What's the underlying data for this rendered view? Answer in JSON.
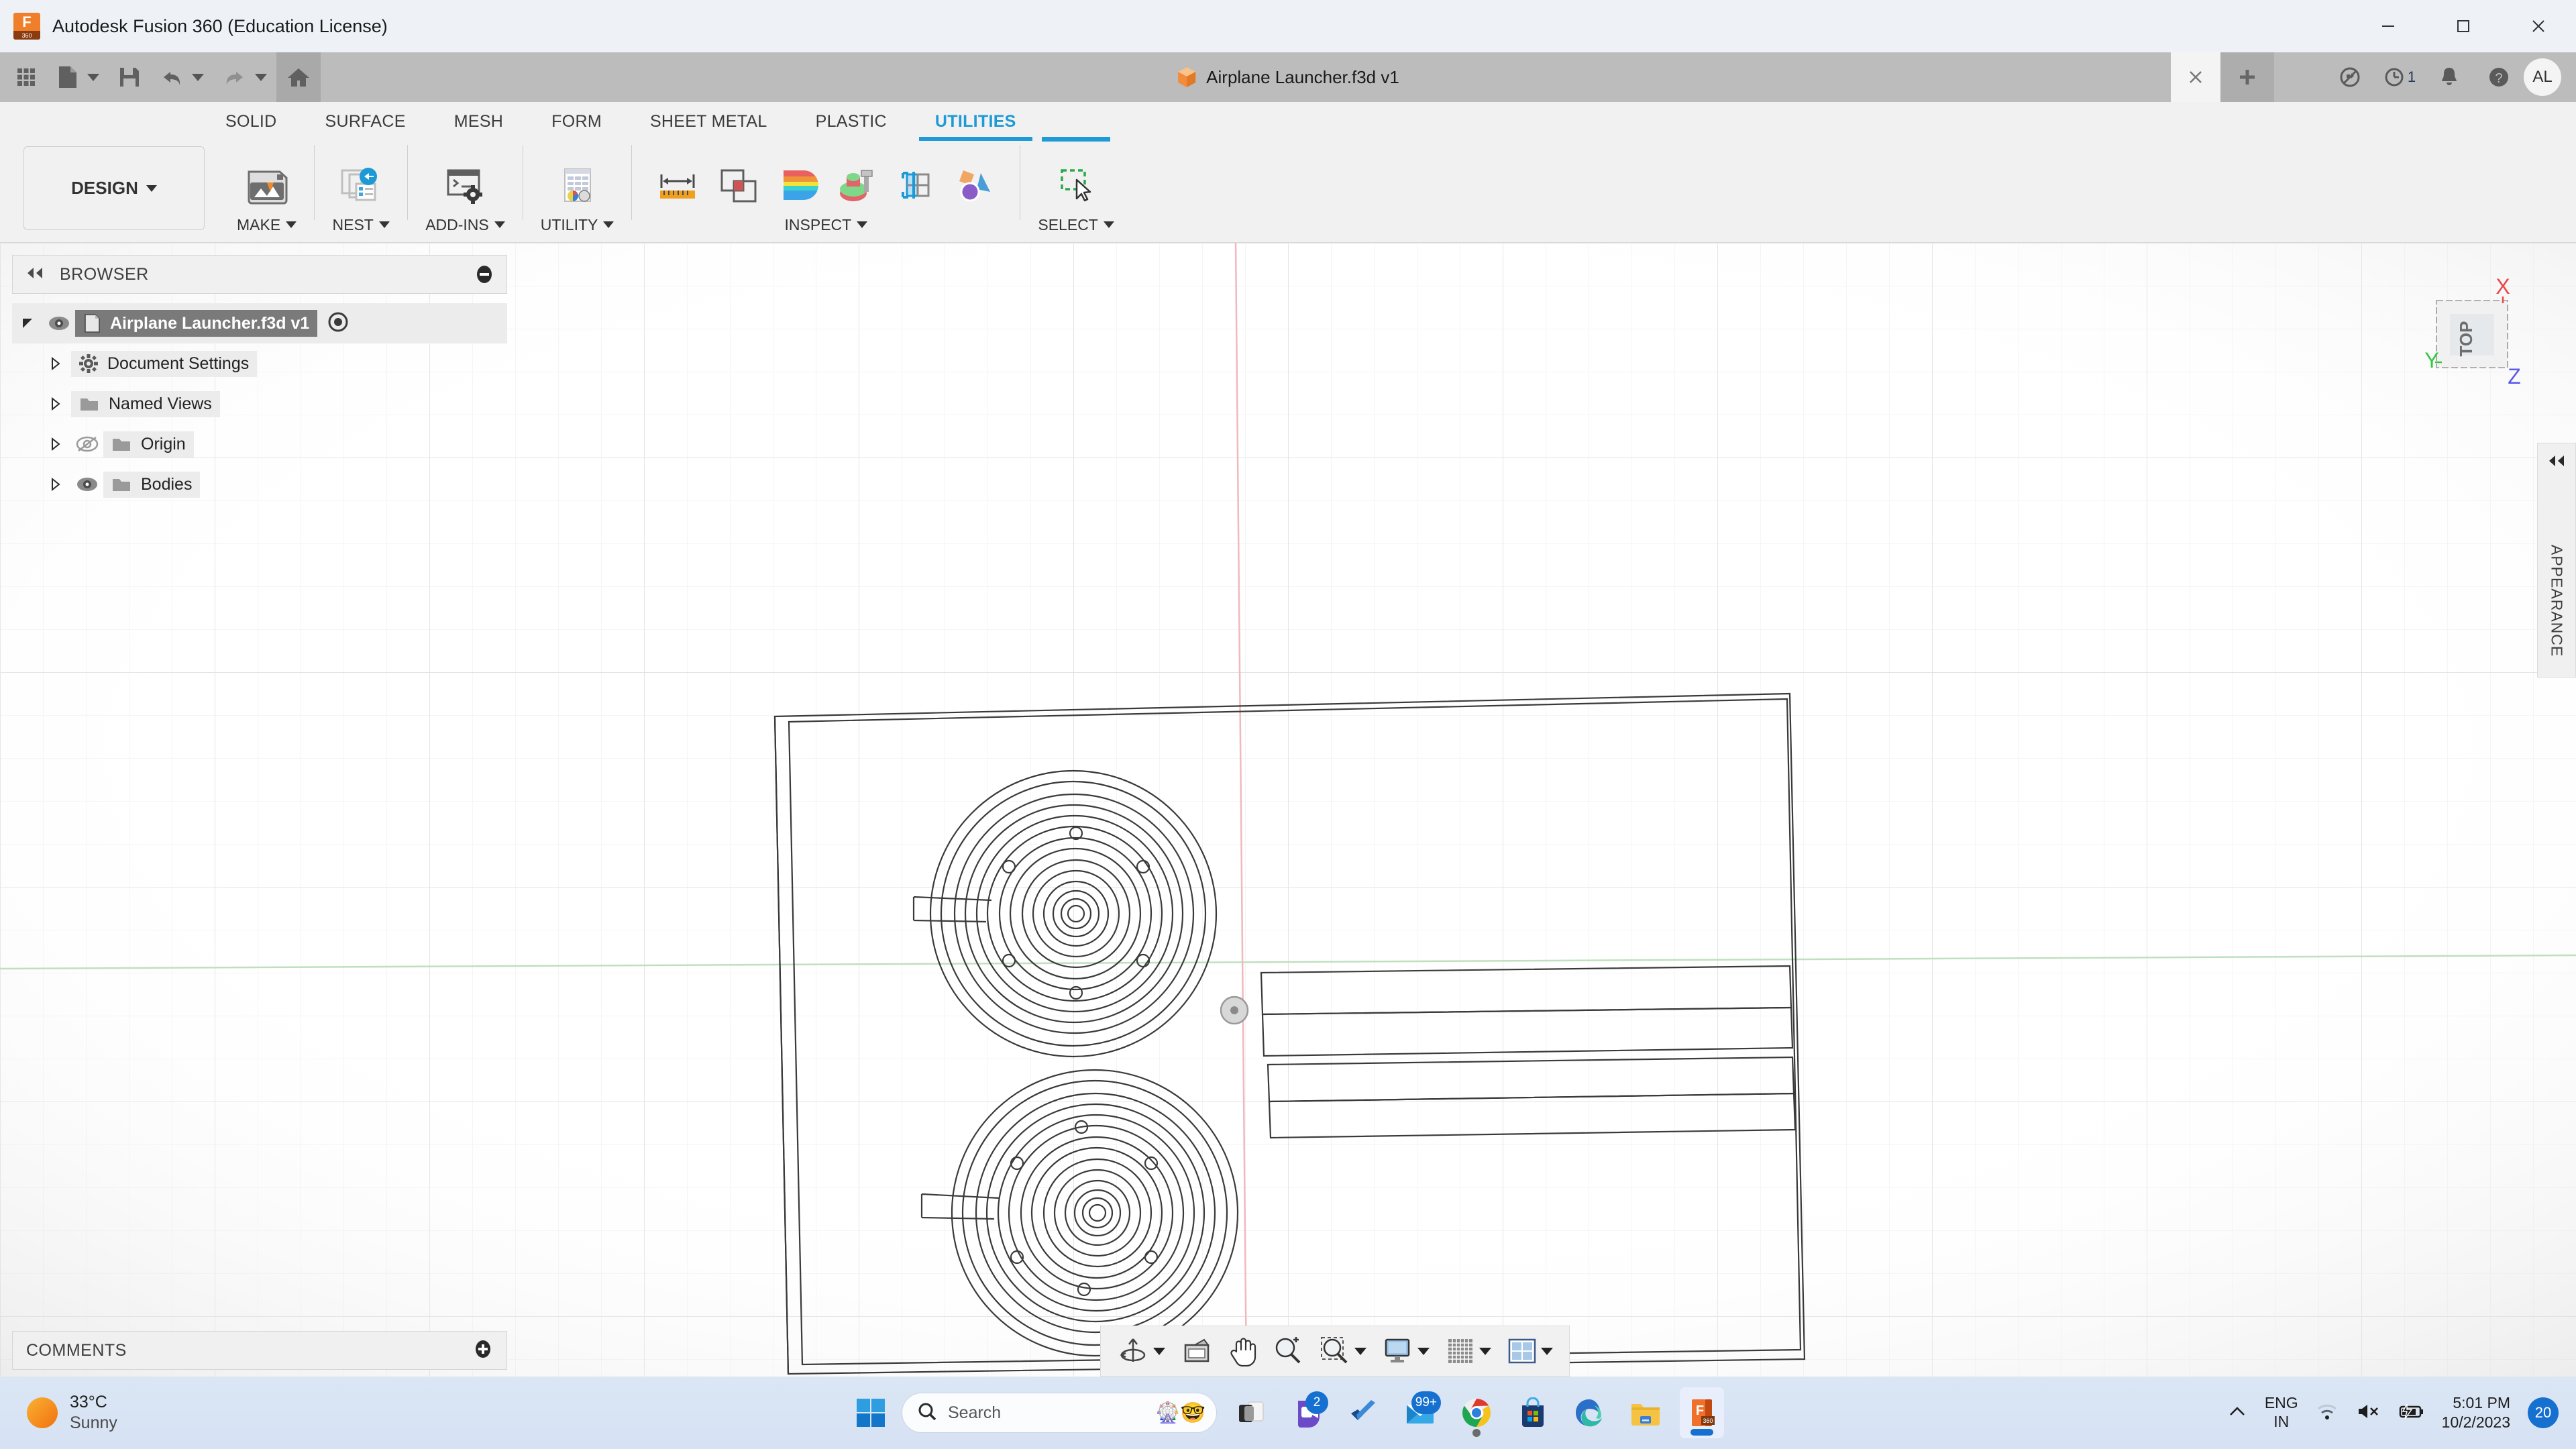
{
  "window": {
    "title": "Autodesk Fusion 360 (Education License)",
    "logo_icon": "fusion360-logo-icon",
    "logo_text": "F",
    "logo_sub": "360",
    "minimize_icon": "minimize-icon",
    "maximize_icon": "maximize-icon",
    "close_icon": "close-icon"
  },
  "quick_access": {
    "apps_icon": "grid-apps-icon",
    "new_file_icon": "new-file-icon",
    "save_icon": "save-icon",
    "undo_icon": "undo-icon",
    "redo_icon": "redo-icon",
    "home_icon": "home-icon"
  },
  "document_tab": {
    "label": "Airplane Launcher.f3d v1",
    "icon": "orange-cube-icon",
    "close_icon": "close-tab-icon",
    "add_icon": "add-tab-icon"
  },
  "status_icons": {
    "offline_icon": "cloud-offline-icon",
    "jobs_icon": "job-status-clock-icon",
    "jobs_count": "1",
    "notifications_icon": "bell-icon",
    "help_icon": "help-question-icon",
    "avatar_initials": "AL"
  },
  "ribbon": {
    "design_label": "DESIGN",
    "tabs": [
      {
        "label": "SOLID",
        "active": false
      },
      {
        "label": "SURFACE",
        "active": false
      },
      {
        "label": "MESH",
        "active": false
      },
      {
        "label": "FORM",
        "active": false
      },
      {
        "label": "SHEET METAL",
        "active": false
      },
      {
        "label": "PLASTIC",
        "active": false
      },
      {
        "label": "UTILITIES",
        "active": true
      }
    ],
    "panels": [
      {
        "label": "MAKE",
        "icon": "3d-print-icon"
      },
      {
        "label": "NEST",
        "icon": "nest-plugin-icon"
      },
      {
        "label": "ADD-INS",
        "icon": "addins-console-gear-icon"
      },
      {
        "label": "UTILITY",
        "icon": "utility-report-icon"
      },
      {
        "label": "INSPECT",
        "icon": "inspect-panel"
      },
      {
        "label": "SELECT",
        "icon": "select-marquee-cursor-icon"
      }
    ],
    "inspect_tools": [
      {
        "name": "measure-icon"
      },
      {
        "name": "interference-icon"
      },
      {
        "name": "curvature-comb-icon"
      },
      {
        "name": "zebra-analysis-icon"
      },
      {
        "name": "section-analysis-icon"
      },
      {
        "name": "component-color-toggle-icon"
      }
    ]
  },
  "browser": {
    "title": "BROWSER",
    "collapse_icon": "collapse-left-icon",
    "minimize_icon": "minus-circle-icon",
    "items": [
      {
        "label": "Airplane Launcher.f3d v1",
        "icon": "document-icon",
        "eye": "eye-visible-icon",
        "selected": true,
        "indent": 0,
        "radio": true,
        "disclosure": "expanded"
      },
      {
        "label": "Document Settings",
        "icon": "gear-icon",
        "eye": "",
        "selected": false,
        "indent": 1,
        "radio": false,
        "disclosure": "collapsed"
      },
      {
        "label": "Named Views",
        "icon": "folder-icon",
        "eye": "",
        "selected": false,
        "indent": 1,
        "radio": false,
        "disclosure": "collapsed"
      },
      {
        "label": "Origin",
        "icon": "folder-icon",
        "eye": "eye-hidden-icon",
        "selected": false,
        "indent": 1,
        "radio": false,
        "disclosure": "collapsed"
      },
      {
        "label": "Bodies",
        "icon": "folder-icon",
        "eye": "eye-visible-icon",
        "selected": false,
        "indent": 1,
        "radio": false,
        "disclosure": "collapsed"
      }
    ]
  },
  "viewcube": {
    "face": "TOP",
    "axis_x": "X",
    "axis_y": "Y",
    "axis_z": "Z",
    "color_x": "#e8484a",
    "color_y": "#35c742",
    "color_z": "#5a5ae8"
  },
  "appearance_panel": {
    "label": "APPEARANCE",
    "collapse_icon": "collapse-right-icon"
  },
  "comments": {
    "label": "COMMENTS",
    "add_icon": "plus-circle-icon"
  },
  "navbar": {
    "items": [
      {
        "name": "orbit-icon",
        "caret": true
      },
      {
        "name": "look-at-icon",
        "caret": false
      },
      {
        "name": "pan-hand-icon",
        "caret": false
      },
      {
        "name": "zoom-icon",
        "caret": false
      },
      {
        "name": "zoom-window-icon",
        "caret": true
      },
      {
        "name": "display-settings-icon",
        "caret": true
      },
      {
        "name": "grid-snaps-icon",
        "caret": true
      },
      {
        "name": "viewport-layout-icon",
        "caret": true
      }
    ]
  },
  "taskbar": {
    "weather": {
      "temperature": "33°C",
      "condition": "Sunny",
      "icon": "sun-icon"
    },
    "start_icon": "windows-start-icon",
    "search": {
      "placeholder": "Search",
      "icon": "search-icon",
      "emoji_icon": "search-illustration-icon"
    },
    "apps": [
      {
        "name": "task-view-icon",
        "badge": "",
        "state": ""
      },
      {
        "name": "teams-icon",
        "badge": "2",
        "state": ""
      },
      {
        "name": "todo-icon",
        "badge": "",
        "state": ""
      },
      {
        "name": "mail-icon",
        "badge": "99+",
        "state": ""
      },
      {
        "name": "chrome-icon",
        "badge": "",
        "state": "running"
      },
      {
        "name": "microsoft-store-icon",
        "badge": "",
        "state": ""
      },
      {
        "name": "edge-icon",
        "badge": "",
        "state": ""
      },
      {
        "name": "file-explorer-icon",
        "badge": "",
        "state": ""
      },
      {
        "name": "fusion360-taskbar-icon",
        "badge": "",
        "state": "active"
      }
    ],
    "tray": {
      "chevron_icon": "chevron-up-icon",
      "language_line1": "ENG",
      "language_line2": "IN",
      "wifi_icon": "wifi-icon",
      "volume_icon": "volume-muted-icon",
      "battery_icon": "battery-charging-icon",
      "time": "5:01 PM",
      "date": "10/2/2023",
      "notification_count": "20"
    }
  }
}
